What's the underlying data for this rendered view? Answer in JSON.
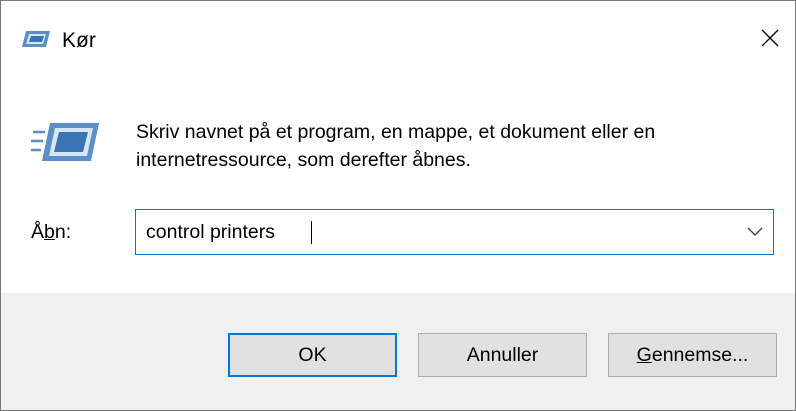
{
  "window": {
    "title": "Kør",
    "icon": "run-dialog-icon",
    "close_icon": "close-icon"
  },
  "body": {
    "description": "Skriv navnet på et program, en mappe, et dokument eller en internetressource, som derefter åbnes.",
    "open_label_prefix": "Å",
    "open_label_mnemonic": "b",
    "open_label_suffix": "n:",
    "input_value": "control printers",
    "dropdown_icon": "chevron-down-icon"
  },
  "buttons": {
    "ok_label": "OK",
    "cancel_label": "Annuller",
    "browse_mnemonic": "G",
    "browse_rest": "ennemse..."
  },
  "colors": {
    "accent": "#0078d7",
    "footer_bg": "#f0f0f0",
    "button_bg": "#e1e1e1"
  }
}
